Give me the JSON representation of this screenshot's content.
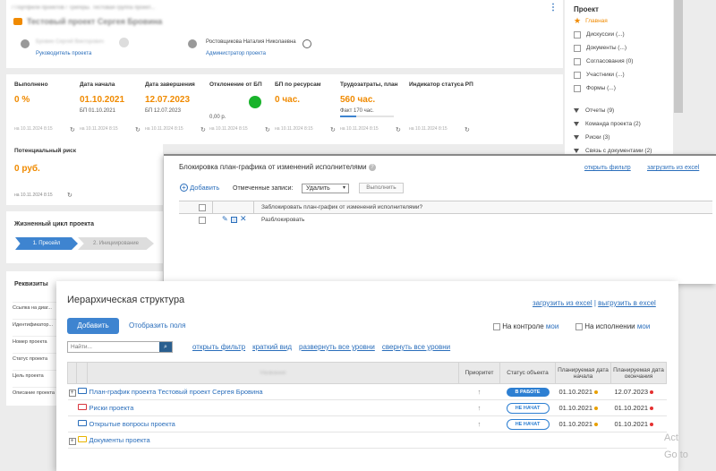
{
  "header": {
    "breadcrumb": "/ Портфели проектов / Тригеры. Тестовая группа проект...",
    "project_title": "Тестовый проект Сергея Бровина",
    "manager_name": "Бровин Сергей Викторович",
    "manager_role": "Руководитель проекта",
    "admin_name": "Ростовщикова Наталия Николаевна",
    "admin_role": "Администратор проекта"
  },
  "kpis": [
    {
      "title": "Выполнено",
      "value": "0 %",
      "sub": "",
      "updated": "на 10.11.2024 8:15"
    },
    {
      "title": "Дата начала",
      "value": "01.10.2021",
      "sub": "БП  01.10.2021",
      "updated": "на 10.11.2024 8:15"
    },
    {
      "title": "Дата завершения",
      "value": "12.07.2023",
      "sub": "БП  12.07.2023",
      "updated": "на 10.11.2024 8:15"
    },
    {
      "title": "Отклонение от БП",
      "value": "",
      "sub": "0,00 р.",
      "updated": "на 10.11.2024 8:15"
    },
    {
      "title": "БП по ресурсам",
      "value": "0 час.",
      "sub": "",
      "updated": "на 10.11.2024 8:15"
    },
    {
      "title": "Трудозатраты, план",
      "value": "560 час.",
      "sub": "Факт  170 час.",
      "updated": "на 10.11.2024 8:15"
    },
    {
      "title": "Индикатор статуса РП",
      "value": "",
      "sub": "",
      "updated": "на 10.11.2024 8:15"
    }
  ],
  "risk": {
    "title": "Потенциальный риск",
    "value": "0 руб.",
    "updated": "на 10.11.2024 8:15"
  },
  "lifecycle": {
    "title": "Жизненный цикл проекта",
    "steps": [
      "1. Пресейл",
      "2. Инициирование"
    ]
  },
  "requisites": {
    "title": "Реквизиты",
    "rows": [
      "Ссылка на диаг...",
      "Идентификатор...",
      "Номер проекта",
      "Статус проекта",
      "Цель проекта",
      "Описание проекта"
    ]
  },
  "sidebar": {
    "title": "Проект",
    "items": [
      "Главная",
      "Дискуссии (...)",
      "Документы (...)",
      "Согласования (0)",
      "Участники (...)",
      "Формы (...)"
    ],
    "groups": [
      "Отчеты (9)",
      "Команда проекта (2)",
      "Риски (3)",
      "Связь с документами (2)"
    ]
  },
  "block_panel": {
    "title": "Блокировка план-графика от изменений исполнителями",
    "filter_link": "открыть фильтр",
    "excel_link": "загрузить из excel",
    "add_label": "Добавить",
    "marked_label": "Отмеченные записи:",
    "action_value": "Удалить",
    "execute_label": "Выполнить",
    "column_header": "Заблокировать план-график от изменений исполнителями?",
    "row_value": "Разблокировать"
  },
  "hierarchy": {
    "title": "Иерархическая структура",
    "import_link": "загрузить из excel",
    "separator": "|",
    "export_link": "выгрузить в excel",
    "add_button": "Добавить",
    "fields_link": "Отобразить поля",
    "control_label": "На контроле",
    "control_mine": "мои",
    "exec_label": "На исполнении",
    "exec_mine": "мои",
    "search_placeholder": "Найти...",
    "actions": [
      "открыть фильтр",
      "краткий вид",
      "развернуть все уровни",
      "свернуть все уровни"
    ],
    "columns": [
      "Название",
      "Приоритет",
      "Статус объекта",
      "Планируемая дата начала",
      "Планируемая дата окончания"
    ],
    "rows": [
      {
        "name": "План-график проекта Тестовый проект Сергея Бровина",
        "status": "В РАБОТЕ",
        "start": "01.10.2021",
        "end": "12.07.2023",
        "expand": true,
        "icon_color": "#2a6ebb"
      },
      {
        "name": "Риски проекта",
        "status": "НЕ НАЧАТ",
        "start": "01.10.2021",
        "end": "01.10.2021",
        "expand": false,
        "icon_color": "#d9363e"
      },
      {
        "name": "Открытые вопросы проекта",
        "status": "НЕ НАЧАТ",
        "start": "01.10.2021",
        "end": "01.10.2021",
        "expand": false,
        "icon_color": "#2a6ebb"
      },
      {
        "name": "Документы проекта",
        "status": "",
        "start": "",
        "end": "",
        "expand": true,
        "icon_color": "#e8b400"
      }
    ]
  },
  "watermark": {
    "line1": "Act",
    "line2": "Go to"
  }
}
